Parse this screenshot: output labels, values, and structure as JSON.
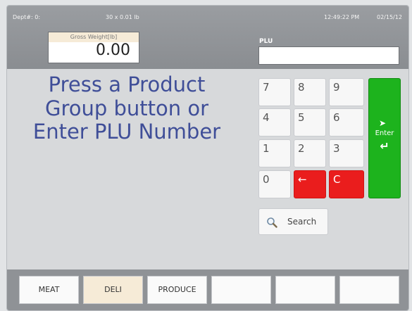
{
  "header": {
    "dept": "Dept#: 0:",
    "scale_info": "30 x 0.01 lb",
    "time": "12:49:22 PM",
    "date": "02/15/12"
  },
  "weight": {
    "label": "Gross  Weight[lb]",
    "value": "0.00"
  },
  "plu": {
    "label": "PLU",
    "value": ""
  },
  "prompt": {
    "line1": "Press a Product",
    "line2": "Group button or",
    "line3": "Enter PLU Number"
  },
  "keypad": {
    "k7": "7",
    "k8": "8",
    "k9": "9",
    "k4": "4",
    "k5": "5",
    "k6": "6",
    "k1": "1",
    "k2": "2",
    "k3": "3",
    "k0": "0",
    "backspace": "←",
    "clear": "C",
    "enter": "Enter",
    "enter_arrow": "↵"
  },
  "search": {
    "label": "Search"
  },
  "categories": {
    "meat": "MEAT",
    "deli": "DELI",
    "produce": "PRODUCE",
    "empty1": "",
    "empty2": "",
    "empty3": ""
  },
  "colors": {
    "prompt_text": "#3f4e98",
    "enter_key": "#1db31d",
    "red_keys": "#ea1d1d",
    "selected_category": "#f6ebd7"
  }
}
